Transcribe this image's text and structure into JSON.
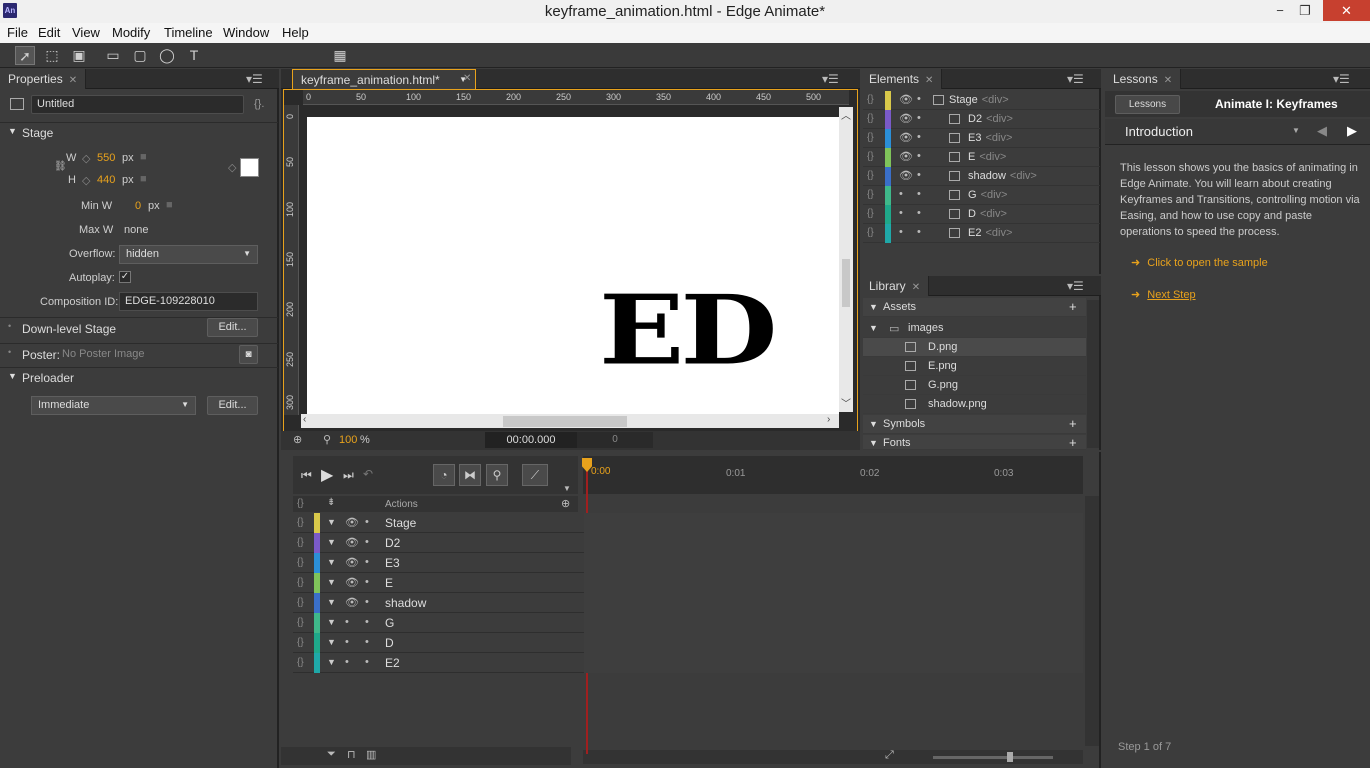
{
  "window": {
    "title": "keyframe_animation.html - Edge Animate*",
    "app_icon": "An",
    "minimize": "−",
    "maximize": "❐",
    "close": "✕"
  },
  "menu": [
    "File",
    "Edit",
    "View",
    "Modify",
    "Timeline",
    "Window",
    "Help"
  ],
  "properties": {
    "tab": "Properties",
    "name": "Untitled",
    "stage_label": "Stage",
    "w_label": "W",
    "w": "550",
    "h_label": "H",
    "h": "440",
    "unit": "px",
    "minw_label": "Min W",
    "minw": "0",
    "maxw_label": "Max W",
    "maxw": "none",
    "overflow_label": "Overflow:",
    "overflow": "hidden",
    "autoplay_label": "Autoplay:",
    "autoplay_check": "✓",
    "compid_label": "Composition ID:",
    "compid": "EDGE-109228010",
    "downlevel_label": "Down-level Stage",
    "edit": "Edit...",
    "poster_label": "Poster:",
    "poster_value": "No Poster Image",
    "preloader_label": "Preloader",
    "preloader_value": "Immediate"
  },
  "document": {
    "tab": "keyframe_animation.html*",
    "zoom": "100",
    "zoom_unit": "%",
    "time": "00:00.000",
    "frame": "0",
    "ruler_x": [
      "0",
      "50",
      "100",
      "150",
      "200",
      "250",
      "300",
      "350",
      "400",
      "450",
      "500"
    ],
    "ruler_y": [
      "0",
      "50",
      "100",
      "150",
      "200",
      "250",
      "300"
    ],
    "stage_text": "ED"
  },
  "elements": {
    "tab": "Elements",
    "rows": [
      {
        "name": "Stage",
        "tag": "<div>",
        "color": "#d8c84a"
      },
      {
        "name": "D2",
        "tag": "<div>",
        "color": "#7a5ac8"
      },
      {
        "name": "E3",
        "tag": "<div>",
        "color": "#2b8fd8"
      },
      {
        "name": "E",
        "tag": "<div>",
        "color": "#7fc35a"
      },
      {
        "name": "shadow",
        "tag": "<div>",
        "color": "#3a6fc8"
      },
      {
        "name": "G",
        "tag": "<div>",
        "color": "#3fb88a"
      },
      {
        "name": "D",
        "tag": "<div>",
        "color": "#1fa88a"
      },
      {
        "name": "E2",
        "tag": "<div>",
        "color": "#1fa8a8"
      }
    ]
  },
  "library": {
    "tab": "Library",
    "assets": "Assets",
    "folder": "images",
    "files": [
      "D.png",
      "E.png",
      "G.png",
      "shadow.png"
    ],
    "symbols": "Symbols",
    "fonts": "Fonts"
  },
  "lessons": {
    "tab": "Lessons",
    "back": "Lessons",
    "title": "Animate I: Keyframes",
    "section": "Introduction",
    "body": "This lesson shows you the basics of animating in Edge Animate. You will learn about creating Keyframes and Transitions, controlling motion via Easing, and how to use copy and paste operations to speed the process.",
    "link1": "Click to open the sample",
    "link2": "Next Step",
    "step": "Step 1 of 7"
  },
  "timeline": {
    "actions": "Actions",
    "times": [
      "0:00",
      "0:01",
      "0:02",
      "0:03"
    ],
    "rows": [
      {
        "name": "Stage",
        "color": "#d8c84a",
        "eye": true
      },
      {
        "name": "D2",
        "color": "#7a5ac8",
        "eye": true
      },
      {
        "name": "E3",
        "color": "#2b8fd8",
        "eye": true
      },
      {
        "name": "E",
        "color": "#7fc35a",
        "eye": true
      },
      {
        "name": "shadow",
        "color": "#3a6fc8",
        "eye": true
      },
      {
        "name": "G",
        "color": "#3fb88a",
        "eye": false
      },
      {
        "name": "D",
        "color": "#1fa88a",
        "eye": false
      },
      {
        "name": "E2",
        "color": "#1fa8a8",
        "eye": false
      }
    ]
  }
}
